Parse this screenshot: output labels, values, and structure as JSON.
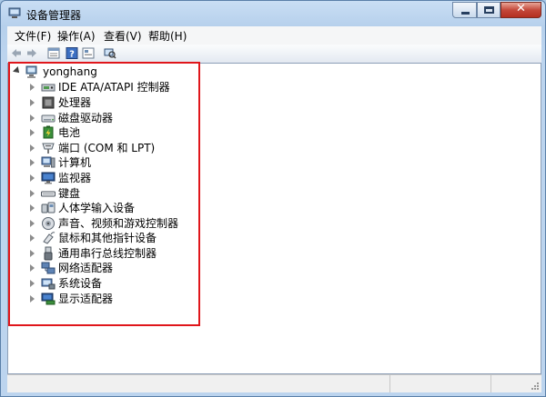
{
  "window": {
    "title": "设备管理器",
    "close_glyph": "✕"
  },
  "menu": [
    {
      "label": "文件(F)"
    },
    {
      "label": "操作(A)"
    },
    {
      "label": "查看(V)"
    },
    {
      "label": "帮助(H)"
    }
  ],
  "toolbar": {
    "buttons": [
      "back-arrow-icon",
      "forward-arrow-icon",
      "properties-icon",
      "help-icon",
      "view-icon",
      "scan-hardware-icon"
    ]
  },
  "tree": {
    "root": "yonghang",
    "items": [
      {
        "label": "IDE ATA/ATAPI 控制器",
        "icon": "ide-controller-icon"
      },
      {
        "label": "处理器",
        "icon": "processor-icon"
      },
      {
        "label": "磁盘驱动器",
        "icon": "disk-drive-icon"
      },
      {
        "label": "电池",
        "icon": "battery-icon"
      },
      {
        "label": "端口 (COM 和 LPT)",
        "icon": "port-icon"
      },
      {
        "label": "计算机",
        "icon": "computer-icon"
      },
      {
        "label": "监视器",
        "icon": "monitor-icon"
      },
      {
        "label": "键盘",
        "icon": "keyboard-icon"
      },
      {
        "label": "人体学输入设备",
        "icon": "hid-icon"
      },
      {
        "label": "声音、视频和游戏控制器",
        "icon": "sound-icon"
      },
      {
        "label": "鼠标和其他指针设备",
        "icon": "mouse-icon"
      },
      {
        "label": "通用串行总线控制器",
        "icon": "usb-icon"
      },
      {
        "label": "网络适配器",
        "icon": "network-adapter-icon"
      },
      {
        "label": "系统设备",
        "icon": "system-device-icon"
      },
      {
        "label": "显示适配器",
        "icon": "display-adapter-icon"
      }
    ]
  },
  "colors": {
    "highlight": "#e0161b",
    "title_bar": "#c9def4",
    "close_button": "#c4483a"
  }
}
